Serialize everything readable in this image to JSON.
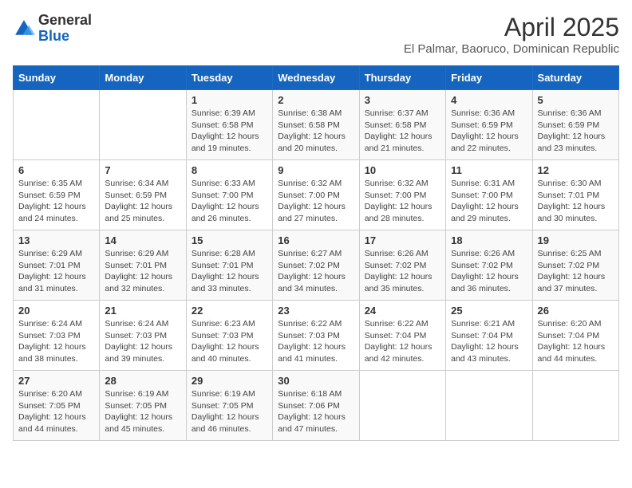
{
  "header": {
    "logo": {
      "general": "General",
      "blue": "Blue"
    },
    "title": "April 2025",
    "location": "El Palmar, Baoruco, Dominican Republic"
  },
  "weekdays": [
    "Sunday",
    "Monday",
    "Tuesday",
    "Wednesday",
    "Thursday",
    "Friday",
    "Saturday"
  ],
  "weeks": [
    [
      {
        "day": "",
        "info": ""
      },
      {
        "day": "",
        "info": ""
      },
      {
        "day": "1",
        "info": "Sunrise: 6:39 AM\nSunset: 6:58 PM\nDaylight: 12 hours and 19 minutes."
      },
      {
        "day": "2",
        "info": "Sunrise: 6:38 AM\nSunset: 6:58 PM\nDaylight: 12 hours and 20 minutes."
      },
      {
        "day": "3",
        "info": "Sunrise: 6:37 AM\nSunset: 6:58 PM\nDaylight: 12 hours and 21 minutes."
      },
      {
        "day": "4",
        "info": "Sunrise: 6:36 AM\nSunset: 6:59 PM\nDaylight: 12 hours and 22 minutes."
      },
      {
        "day": "5",
        "info": "Sunrise: 6:36 AM\nSunset: 6:59 PM\nDaylight: 12 hours and 23 minutes."
      }
    ],
    [
      {
        "day": "6",
        "info": "Sunrise: 6:35 AM\nSunset: 6:59 PM\nDaylight: 12 hours and 24 minutes."
      },
      {
        "day": "7",
        "info": "Sunrise: 6:34 AM\nSunset: 6:59 PM\nDaylight: 12 hours and 25 minutes."
      },
      {
        "day": "8",
        "info": "Sunrise: 6:33 AM\nSunset: 7:00 PM\nDaylight: 12 hours and 26 minutes."
      },
      {
        "day": "9",
        "info": "Sunrise: 6:32 AM\nSunset: 7:00 PM\nDaylight: 12 hours and 27 minutes."
      },
      {
        "day": "10",
        "info": "Sunrise: 6:32 AM\nSunset: 7:00 PM\nDaylight: 12 hours and 28 minutes."
      },
      {
        "day": "11",
        "info": "Sunrise: 6:31 AM\nSunset: 7:00 PM\nDaylight: 12 hours and 29 minutes."
      },
      {
        "day": "12",
        "info": "Sunrise: 6:30 AM\nSunset: 7:01 PM\nDaylight: 12 hours and 30 minutes."
      }
    ],
    [
      {
        "day": "13",
        "info": "Sunrise: 6:29 AM\nSunset: 7:01 PM\nDaylight: 12 hours and 31 minutes."
      },
      {
        "day": "14",
        "info": "Sunrise: 6:29 AM\nSunset: 7:01 PM\nDaylight: 12 hours and 32 minutes."
      },
      {
        "day": "15",
        "info": "Sunrise: 6:28 AM\nSunset: 7:01 PM\nDaylight: 12 hours and 33 minutes."
      },
      {
        "day": "16",
        "info": "Sunrise: 6:27 AM\nSunset: 7:02 PM\nDaylight: 12 hours and 34 minutes."
      },
      {
        "day": "17",
        "info": "Sunrise: 6:26 AM\nSunset: 7:02 PM\nDaylight: 12 hours and 35 minutes."
      },
      {
        "day": "18",
        "info": "Sunrise: 6:26 AM\nSunset: 7:02 PM\nDaylight: 12 hours and 36 minutes."
      },
      {
        "day": "19",
        "info": "Sunrise: 6:25 AM\nSunset: 7:02 PM\nDaylight: 12 hours and 37 minutes."
      }
    ],
    [
      {
        "day": "20",
        "info": "Sunrise: 6:24 AM\nSunset: 7:03 PM\nDaylight: 12 hours and 38 minutes."
      },
      {
        "day": "21",
        "info": "Sunrise: 6:24 AM\nSunset: 7:03 PM\nDaylight: 12 hours and 39 minutes."
      },
      {
        "day": "22",
        "info": "Sunrise: 6:23 AM\nSunset: 7:03 PM\nDaylight: 12 hours and 40 minutes."
      },
      {
        "day": "23",
        "info": "Sunrise: 6:22 AM\nSunset: 7:03 PM\nDaylight: 12 hours and 41 minutes."
      },
      {
        "day": "24",
        "info": "Sunrise: 6:22 AM\nSunset: 7:04 PM\nDaylight: 12 hours and 42 minutes."
      },
      {
        "day": "25",
        "info": "Sunrise: 6:21 AM\nSunset: 7:04 PM\nDaylight: 12 hours and 43 minutes."
      },
      {
        "day": "26",
        "info": "Sunrise: 6:20 AM\nSunset: 7:04 PM\nDaylight: 12 hours and 44 minutes."
      }
    ],
    [
      {
        "day": "27",
        "info": "Sunrise: 6:20 AM\nSunset: 7:05 PM\nDaylight: 12 hours and 44 minutes."
      },
      {
        "day": "28",
        "info": "Sunrise: 6:19 AM\nSunset: 7:05 PM\nDaylight: 12 hours and 45 minutes."
      },
      {
        "day": "29",
        "info": "Sunrise: 6:19 AM\nSunset: 7:05 PM\nDaylight: 12 hours and 46 minutes."
      },
      {
        "day": "30",
        "info": "Sunrise: 6:18 AM\nSunset: 7:06 PM\nDaylight: 12 hours and 47 minutes."
      },
      {
        "day": "",
        "info": ""
      },
      {
        "day": "",
        "info": ""
      },
      {
        "day": "",
        "info": ""
      }
    ]
  ]
}
